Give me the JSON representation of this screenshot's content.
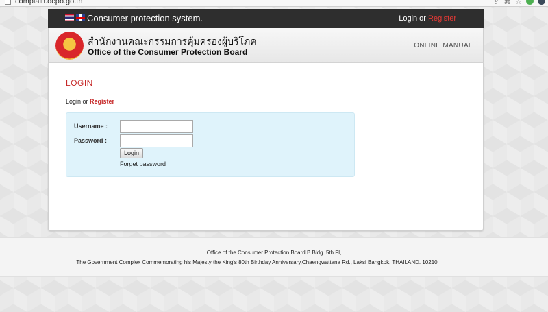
{
  "browser": {
    "url": "complain.ocpb.go.th"
  },
  "topbar": {
    "system_title": "Consumer protection system.",
    "login_label": "Login",
    "or_text": " or ",
    "register_label": "Register"
  },
  "header": {
    "thai_name": "สำนักงานคณะกรรมการคุ้มครองผู้บริโภค",
    "english_name": "Office of the Consumer Protection Board",
    "manual_label": "ONLINE MANUAL"
  },
  "login": {
    "heading": "LOGIN",
    "sub_login": "Login",
    "sub_or": " or ",
    "sub_register": "Register",
    "username_label": "Username :",
    "password_label": "Password :",
    "username_value": "",
    "password_value": "",
    "button_label": "Login",
    "forgot_label": "Forget password"
  },
  "footer": {
    "line1": "Office of the Consumer Protection Board B Bldg. 5th Fl,",
    "line2": "The Government Complex Commemorating his Majesty the King's 80th Birthday Anniversary,Chaengwattana Rd., Laksi Bangkok, THAILAND. 10210"
  },
  "colors": {
    "accent_red": "#c62828",
    "topbar_bg": "#2e2e2e",
    "panel_bg": "#dff3fb"
  }
}
